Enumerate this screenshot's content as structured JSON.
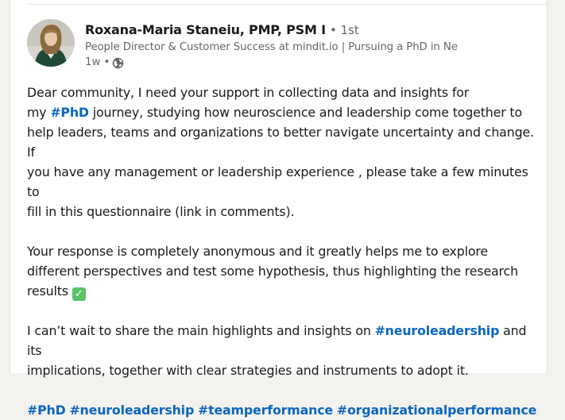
{
  "author": {
    "name": "Roxana-Maria Staneiu, PMP, PSM I",
    "connection_degree": "• 1st",
    "headline": "People Director & Customer Success at mindit.io | Pursuing a PhD in Neuroleaders…",
    "post_age": "1w •",
    "visibility_icon": "globe-icon"
  },
  "post": {
    "p1_part1": "Dear community, I need your support in collecting data and insights for",
    "p1_part2": "my",
    "p1_tag": "#PhD",
    "p1_part3": " journey, studying how neuroscience and leadership come together to",
    "p1_part4": "help leaders, teams and organizations to better navigate uncertainty and change. If",
    "p1_part5": "you have any management or leadership experience , please take a few minutes to",
    "p1_part6": "fill in this questionnaire (link in comments).",
    "p2_part1": "Your response is completely anonymous and it greatly helps me to explore",
    "p2_part2": "different perspectives and test some hypothesis, thus highlighting the research",
    "p2_part3": "results",
    "p2_emoji": "✓",
    "p3_part1": "I can’t wait to share the main highlights and insights on",
    "p3_tag": "#neuroleadership",
    "p3_part2": " and its",
    "p3_part3": "implications, together with clear strategies and instruments to adopt it.",
    "hashtags": [
      "#PhD",
      "#neuroleadership",
      "#teamperformance",
      "#organizationalperformance"
    ]
  },
  "colors": {
    "link": "#0a66c2",
    "text": "#191919",
    "muted": "#666666",
    "background": "#f4f2ee",
    "card": "#ffffff",
    "check_emoji": "#5cc26a"
  }
}
